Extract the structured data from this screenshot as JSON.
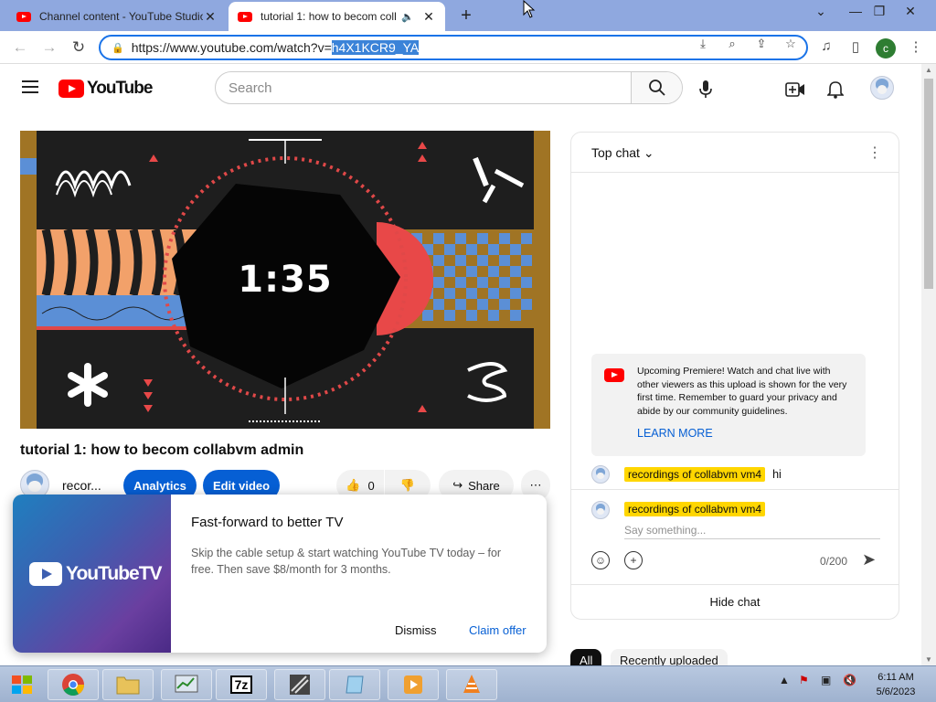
{
  "browser": {
    "tabs": [
      {
        "title": "Channel content - YouTube Studio"
      },
      {
        "title": "tutorial 1: how to becom coll"
      }
    ],
    "url_prefix": "https://www.youtube.com/watch?v=",
    "url_highlight": "h4X1KCR9_YA",
    "profile_initial": "c"
  },
  "masthead": {
    "logo_text": "YouTube",
    "search_placeholder": "Search"
  },
  "video": {
    "timer": "1:35",
    "title": "tutorial 1: how to becom collabvm admin",
    "channel_name": "recor...",
    "analytics_label": "Analytics",
    "edit_label": "Edit video",
    "like_count": "0",
    "share_label": "Share"
  },
  "promo": {
    "brand": "YouTubeTV",
    "title": "Fast-forward to better TV",
    "description": "Skip the cable setup & start watching YouTube TV today – for free. Then save $8/month for 3 months.",
    "dismiss_label": "Dismiss",
    "claim_label": "Claim offer"
  },
  "chat": {
    "header": "Top chat",
    "premiere_message": "Upcoming Premiere! Watch and chat live with other viewers as this upload is shown for the very first time. Remember to guard your privacy and abide by our community guidelines.",
    "learn_more": "LEARN MORE",
    "messages": [
      {
        "author": "recordings of collabvm vm4",
        "text": "hi"
      }
    ],
    "input_author": "recordings of collabvm vm4",
    "input_placeholder": "Say something...",
    "counter": "0/200",
    "hide_chat": "Hide chat"
  },
  "chips": [
    "All",
    "Recently uploaded"
  ],
  "taskbar": {
    "time": "6:11 AM",
    "date": "5/6/2023"
  },
  "colors": {
    "brand_red": "#ff0000",
    "link_blue": "#065fd4",
    "author_highlight": "#ffd600"
  }
}
